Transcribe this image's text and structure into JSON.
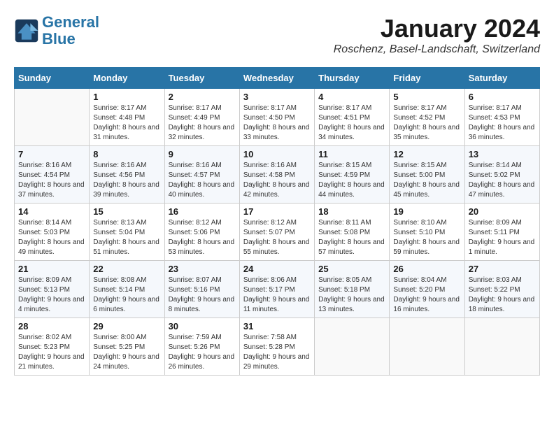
{
  "header": {
    "logo_line1": "General",
    "logo_line2": "Blue",
    "month_title": "January 2024",
    "location": "Roschenz, Basel-Landschaft, Switzerland"
  },
  "weekdays": [
    "Sunday",
    "Monday",
    "Tuesday",
    "Wednesday",
    "Thursday",
    "Friday",
    "Saturday"
  ],
  "weeks": [
    [
      {
        "day": "",
        "sunrise": "",
        "sunset": "",
        "daylight": ""
      },
      {
        "day": "1",
        "sunrise": "Sunrise: 8:17 AM",
        "sunset": "Sunset: 4:48 PM",
        "daylight": "Daylight: 8 hours and 31 minutes."
      },
      {
        "day": "2",
        "sunrise": "Sunrise: 8:17 AM",
        "sunset": "Sunset: 4:49 PM",
        "daylight": "Daylight: 8 hours and 32 minutes."
      },
      {
        "day": "3",
        "sunrise": "Sunrise: 8:17 AM",
        "sunset": "Sunset: 4:50 PM",
        "daylight": "Daylight: 8 hours and 33 minutes."
      },
      {
        "day": "4",
        "sunrise": "Sunrise: 8:17 AM",
        "sunset": "Sunset: 4:51 PM",
        "daylight": "Daylight: 8 hours and 34 minutes."
      },
      {
        "day": "5",
        "sunrise": "Sunrise: 8:17 AM",
        "sunset": "Sunset: 4:52 PM",
        "daylight": "Daylight: 8 hours and 35 minutes."
      },
      {
        "day": "6",
        "sunrise": "Sunrise: 8:17 AM",
        "sunset": "Sunset: 4:53 PM",
        "daylight": "Daylight: 8 hours and 36 minutes."
      }
    ],
    [
      {
        "day": "7",
        "sunrise": "Sunrise: 8:16 AM",
        "sunset": "Sunset: 4:54 PM",
        "daylight": "Daylight: 8 hours and 37 minutes."
      },
      {
        "day": "8",
        "sunrise": "Sunrise: 8:16 AM",
        "sunset": "Sunset: 4:56 PM",
        "daylight": "Daylight: 8 hours and 39 minutes."
      },
      {
        "day": "9",
        "sunrise": "Sunrise: 8:16 AM",
        "sunset": "Sunset: 4:57 PM",
        "daylight": "Daylight: 8 hours and 40 minutes."
      },
      {
        "day": "10",
        "sunrise": "Sunrise: 8:16 AM",
        "sunset": "Sunset: 4:58 PM",
        "daylight": "Daylight: 8 hours and 42 minutes."
      },
      {
        "day": "11",
        "sunrise": "Sunrise: 8:15 AM",
        "sunset": "Sunset: 4:59 PM",
        "daylight": "Daylight: 8 hours and 44 minutes."
      },
      {
        "day": "12",
        "sunrise": "Sunrise: 8:15 AM",
        "sunset": "Sunset: 5:00 PM",
        "daylight": "Daylight: 8 hours and 45 minutes."
      },
      {
        "day": "13",
        "sunrise": "Sunrise: 8:14 AM",
        "sunset": "Sunset: 5:02 PM",
        "daylight": "Daylight: 8 hours and 47 minutes."
      }
    ],
    [
      {
        "day": "14",
        "sunrise": "Sunrise: 8:14 AM",
        "sunset": "Sunset: 5:03 PM",
        "daylight": "Daylight: 8 hours and 49 minutes."
      },
      {
        "day": "15",
        "sunrise": "Sunrise: 8:13 AM",
        "sunset": "Sunset: 5:04 PM",
        "daylight": "Daylight: 8 hours and 51 minutes."
      },
      {
        "day": "16",
        "sunrise": "Sunrise: 8:12 AM",
        "sunset": "Sunset: 5:06 PM",
        "daylight": "Daylight: 8 hours and 53 minutes."
      },
      {
        "day": "17",
        "sunrise": "Sunrise: 8:12 AM",
        "sunset": "Sunset: 5:07 PM",
        "daylight": "Daylight: 8 hours and 55 minutes."
      },
      {
        "day": "18",
        "sunrise": "Sunrise: 8:11 AM",
        "sunset": "Sunset: 5:08 PM",
        "daylight": "Daylight: 8 hours and 57 minutes."
      },
      {
        "day": "19",
        "sunrise": "Sunrise: 8:10 AM",
        "sunset": "Sunset: 5:10 PM",
        "daylight": "Daylight: 8 hours and 59 minutes."
      },
      {
        "day": "20",
        "sunrise": "Sunrise: 8:09 AM",
        "sunset": "Sunset: 5:11 PM",
        "daylight": "Daylight: 9 hours and 1 minute."
      }
    ],
    [
      {
        "day": "21",
        "sunrise": "Sunrise: 8:09 AM",
        "sunset": "Sunset: 5:13 PM",
        "daylight": "Daylight: 9 hours and 4 minutes."
      },
      {
        "day": "22",
        "sunrise": "Sunrise: 8:08 AM",
        "sunset": "Sunset: 5:14 PM",
        "daylight": "Daylight: 9 hours and 6 minutes."
      },
      {
        "day": "23",
        "sunrise": "Sunrise: 8:07 AM",
        "sunset": "Sunset: 5:16 PM",
        "daylight": "Daylight: 9 hours and 8 minutes."
      },
      {
        "day": "24",
        "sunrise": "Sunrise: 8:06 AM",
        "sunset": "Sunset: 5:17 PM",
        "daylight": "Daylight: 9 hours and 11 minutes."
      },
      {
        "day": "25",
        "sunrise": "Sunrise: 8:05 AM",
        "sunset": "Sunset: 5:18 PM",
        "daylight": "Daylight: 9 hours and 13 minutes."
      },
      {
        "day": "26",
        "sunrise": "Sunrise: 8:04 AM",
        "sunset": "Sunset: 5:20 PM",
        "daylight": "Daylight: 9 hours and 16 minutes."
      },
      {
        "day": "27",
        "sunrise": "Sunrise: 8:03 AM",
        "sunset": "Sunset: 5:22 PM",
        "daylight": "Daylight: 9 hours and 18 minutes."
      }
    ],
    [
      {
        "day": "28",
        "sunrise": "Sunrise: 8:02 AM",
        "sunset": "Sunset: 5:23 PM",
        "daylight": "Daylight: 9 hours and 21 minutes."
      },
      {
        "day": "29",
        "sunrise": "Sunrise: 8:00 AM",
        "sunset": "Sunset: 5:25 PM",
        "daylight": "Daylight: 9 hours and 24 minutes."
      },
      {
        "day": "30",
        "sunrise": "Sunrise: 7:59 AM",
        "sunset": "Sunset: 5:26 PM",
        "daylight": "Daylight: 9 hours and 26 minutes."
      },
      {
        "day": "31",
        "sunrise": "Sunrise: 7:58 AM",
        "sunset": "Sunset: 5:28 PM",
        "daylight": "Daylight: 9 hours and 29 minutes."
      },
      {
        "day": "",
        "sunrise": "",
        "sunset": "",
        "daylight": ""
      },
      {
        "day": "",
        "sunrise": "",
        "sunset": "",
        "daylight": ""
      },
      {
        "day": "",
        "sunrise": "",
        "sunset": "",
        "daylight": ""
      }
    ]
  ]
}
